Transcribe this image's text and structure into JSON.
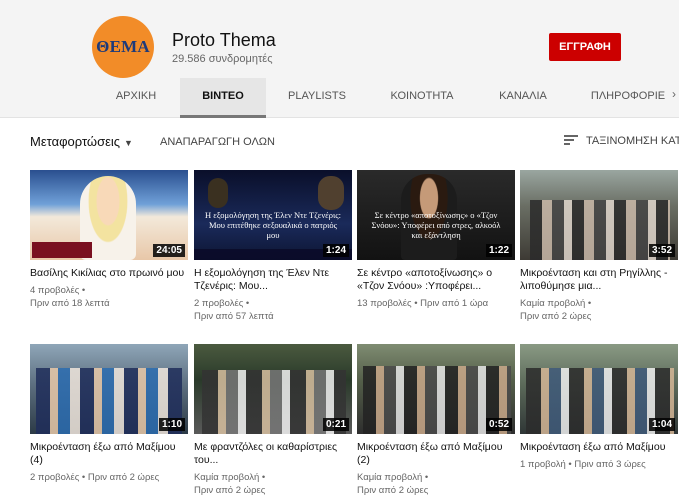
{
  "channel": {
    "logo_text": "ΘΕΜΑ",
    "name": "Proto Thema",
    "subscribers": "29.586 συνδρομητές",
    "subscribe_label": "ΕΓΓΡΑΦΗ"
  },
  "tabs": [
    {
      "label": "ΑΡΧΙΚΗ",
      "active": false
    },
    {
      "label": "ΒΙΝΤΕΟ",
      "active": true
    },
    {
      "label": "PLAYLISTS",
      "active": false
    },
    {
      "label": "ΚΟΙΝΟΤΗΤΑ",
      "active": false
    },
    {
      "label": "ΚΑΝΑΛΙΑ",
      "active": false
    },
    {
      "label": "ΠΛΗΡΟΦΟΡΙΕ",
      "active": false
    }
  ],
  "toolbar": {
    "uploads_label": "Μεταφορτώσεις",
    "play_all_label": "ΑΝΑΠΑΡΑΓΩΓΗ ΟΛΩΝ",
    "sort_label": "ΤΑΞΙΝΟΜΗΣΗ ΚΑΤΑ"
  },
  "videos": [
    {
      "title": "Βασίλης Κικίλιας στο πρωινό μου",
      "meta1": "4 προβολές •",
      "meta2": "Πριν από 18 λεπτά",
      "duration": "24:05",
      "caption": ""
    },
    {
      "title": "Η εξομολόγηση της Έλεν Ντε Τζενέρις: Μου...",
      "meta1": "2 προβολές •",
      "meta2": "Πριν από 57 λεπτά",
      "duration": "1:24",
      "caption": "Η εξομολόγηση της Έλεν Ντε Τζενέρις: Μου επιτέθηκε σεξουαλικά ο πατριός μου"
    },
    {
      "title": "Σε κέντρο «αποτοξίνωσης» ο «Τζον Σνόου» :Υποφέρει...",
      "meta1": "13 προβολές • Πριν από 1 ώρα",
      "meta2": "",
      "duration": "1:22",
      "caption": "Σε κέντρο «αποτοξίνωσης» ο «Τζον Σνόου»: Υποφέρει από στρες, αλκοόλ και εξάντληση"
    },
    {
      "title": "Μικροένταση και στη Ρηγίλλης - λιποθύμησε μια...",
      "meta1": "Καμία προβολή •",
      "meta2": "Πριν από 2 ώρες",
      "duration": "3:52",
      "caption": ""
    },
    {
      "title": "Μικροένταση έξω από Μαξίμου (4)",
      "meta1": "2 προβολές • Πριν από 2 ώρες",
      "meta2": "",
      "duration": "1:10",
      "caption": ""
    },
    {
      "title": "Με φραντζόλες οι καθαρίστριες του...",
      "meta1": "Καμία προβολή •",
      "meta2": "Πριν από 2 ώρες",
      "duration": "0:21",
      "caption": ""
    },
    {
      "title": "Μικροένταση έξω από Μαξίμου (2)",
      "meta1": "Καμία προβολή •",
      "meta2": "Πριν από 2 ώρες",
      "duration": "0:52",
      "caption": ""
    },
    {
      "title": "Μικροένταση έξω από Μαξίμου",
      "meta1": "1 προβολή • Πριν από 3 ώρες",
      "meta2": "",
      "duration": "1:04",
      "caption": ""
    }
  ],
  "colors": {
    "subscribe_red": "#cc0000",
    "logo_orange": "#f28c28",
    "logo_blue": "#1d3a7a"
  }
}
